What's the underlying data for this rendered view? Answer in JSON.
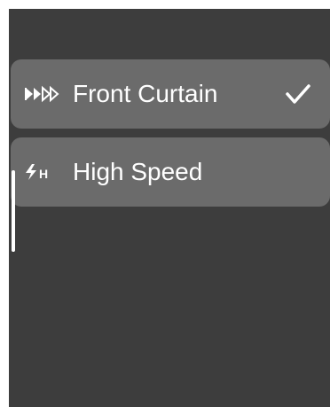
{
  "menu": {
    "items": [
      {
        "label": "Front Curtain",
        "icon": "front-curtain-sync-icon",
        "selected": true
      },
      {
        "label": "High Speed",
        "icon": "high-speed-sync-icon",
        "selected": false
      }
    ]
  },
  "colors": {
    "background": "#3d3d3d",
    "item_background": "#6b6b6b",
    "text": "#ffffff"
  }
}
